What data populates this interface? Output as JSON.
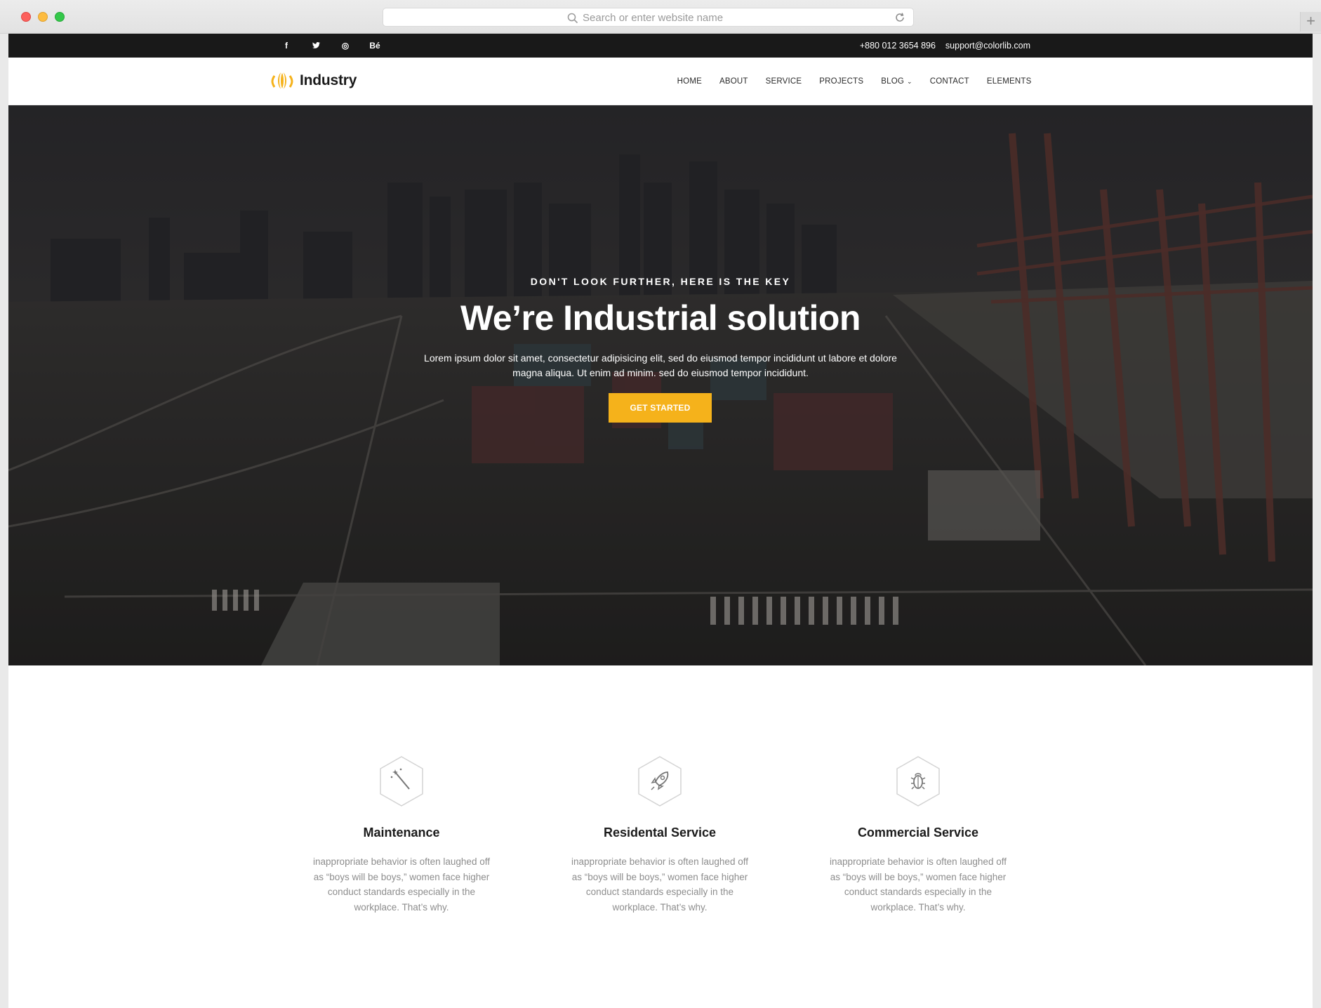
{
  "browser": {
    "address_placeholder": "Search or enter website name",
    "new_tab_label": "+"
  },
  "topbar": {
    "social": [
      "f",
      "❚",
      "◎",
      "Bé"
    ],
    "phone": "+880 012 3654 896",
    "email": "support@colorlib.com"
  },
  "nav": {
    "brand": "Industry",
    "items": [
      {
        "label": "HOME"
      },
      {
        "label": "ABOUT"
      },
      {
        "label": "SERVICE"
      },
      {
        "label": "PROJECTS"
      },
      {
        "label": "BLOG",
        "caret": "⌄"
      },
      {
        "label": "CONTACT"
      },
      {
        "label": "ELEMENTS"
      }
    ]
  },
  "hero": {
    "subtitle": "DON'T LOOK FURTHER, HERE IS THE KEY",
    "title": "We’re Industrial solution",
    "text": "Lorem ipsum dolor sit amet, consectetur adipisicing elit, sed do eiusmod tempor incididunt ut labore et dolore magna aliqua. Ut enim ad minim. sed do eiusmod tempor incididunt.",
    "button": "GET STARTED"
  },
  "services": [
    {
      "icon": "magic-wand-icon",
      "title": "Maintenance",
      "text": "inappropriate behavior is often laughed off as “boys will be boys,” women face higher conduct standards especially in the workplace. That’s why."
    },
    {
      "icon": "rocket-icon",
      "title": "Residental Service",
      "text": "inappropriate behavior is often laughed off as “boys will be boys,” women face higher conduct standards especially in the workplace. That’s why."
    },
    {
      "icon": "bug-icon",
      "title": "Commercial Service",
      "text": "inappropriate behavior is often laughed off as “boys will be boys,” women face higher conduct standards especially in the workplace. That’s why."
    }
  ],
  "colors": {
    "accent": "#f5b21b",
    "topbar": "#191919",
    "heading": "#1b1b1b",
    "body_text": "#8d8d8d"
  }
}
